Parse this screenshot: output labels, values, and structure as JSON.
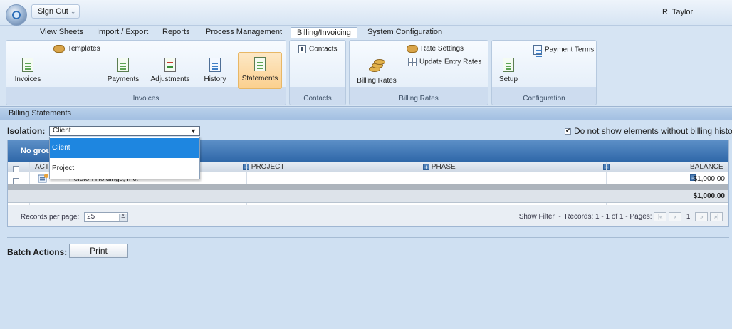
{
  "header": {
    "signout_label": "Sign Out",
    "user_name": "R. Taylor"
  },
  "tabs": [
    "View Sheets",
    "Import / Export",
    "Reports",
    "Process Management",
    "Billing/Invoicing",
    "System Configuration"
  ],
  "active_tab": "Billing/Invoicing",
  "ribbon": {
    "invoices_group": {
      "label": "Invoices",
      "templates": "Templates",
      "invoices": "Invoices",
      "payments": "Payments",
      "adjustments": "Adjustments",
      "history": "History",
      "statements": "Statements"
    },
    "contacts_group": {
      "label": "Contacts",
      "contacts": "Contacts"
    },
    "billing_rates_group": {
      "label": "Billing Rates",
      "billing_rates": "Billing Rates",
      "rate_settings": "Rate Settings",
      "update_entry_rates": "Update Entry Rates"
    },
    "configuration_group": {
      "label": "Configuration",
      "setup": "Setup",
      "payment_terms": "Payment Terms"
    }
  },
  "page_title": "Billing Statements",
  "isolation": {
    "label": "Isolation:",
    "selected": "Client",
    "options": [
      "Client",
      "Project"
    ]
  },
  "hide_checkbox": {
    "label": "Do not show elements without billing history",
    "checked": true
  },
  "grid": {
    "group_header": "No group",
    "columns": {
      "actions": "ACT",
      "project": "PROJECT",
      "phase": "PHASE",
      "balance": "BALANCE"
    },
    "rows": [
      {
        "client": "Peleton Holdings, Inc.",
        "project": "",
        "phase": "",
        "balance": "$1,000.00"
      }
    ],
    "total": "$1,000.00",
    "pager": {
      "records_per_page_label": "Records per page:",
      "records_per_page": "25",
      "show_filter": "Show Filter",
      "sep": "-",
      "records_text": "Records: 1 - 1 of 1 - Pages:",
      "current_page": "1"
    }
  },
  "batch": {
    "label": "Batch Actions:",
    "print": "Print"
  },
  "colors": {
    "accent": "#2f67a8",
    "selection": "#1e86e0",
    "ribbon_selected": "#fbd08e"
  }
}
